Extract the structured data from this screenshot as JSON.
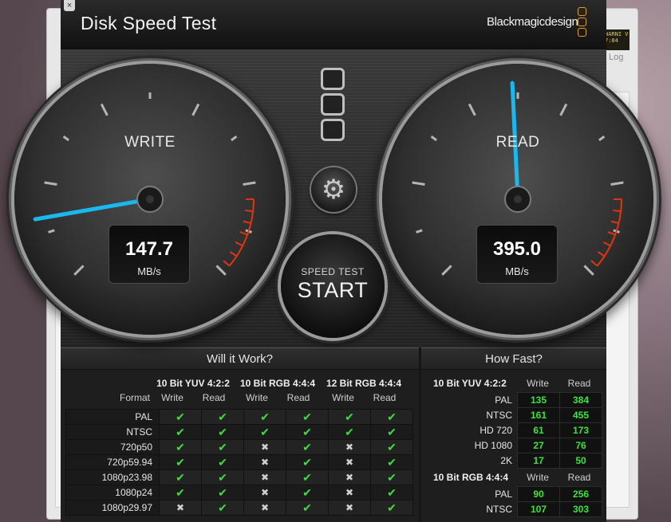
{
  "background": {
    "warning_text": "WARNI V 7:84",
    "log_label": "Log"
  },
  "app": {
    "title": "Disk Speed Test",
    "brand": "Blackmagicdesign",
    "close_glyph": "×",
    "colors": {
      "needle": "#19b8ee",
      "accent_red": "#e03512",
      "ok_green": "#3fdd3f",
      "logo_orange": "#e39b2b"
    }
  },
  "write_gauge": {
    "label": "WRITE",
    "value": "147.7",
    "unit": "MB/s",
    "needle_fraction": 0.13
  },
  "read_gauge": {
    "label": "READ",
    "value": "395.0",
    "unit": "MB/s",
    "needle_fraction": 0.49
  },
  "controls": {
    "gear_icon": "gear-icon",
    "start_small": "SPEED TEST",
    "start_big": "START"
  },
  "will_it_work": {
    "title": "Will it Work?",
    "format_header": "Format",
    "groups": [
      "10 Bit YUV 4:2:2",
      "10 Bit RGB 4:4:4",
      "12 Bit RGB 4:4:4"
    ],
    "sub": [
      "Write",
      "Read",
      "Write",
      "Read",
      "Write",
      "Read"
    ],
    "rows": [
      {
        "format": "PAL",
        "marks": [
          1,
          1,
          1,
          1,
          1,
          1
        ]
      },
      {
        "format": "NTSC",
        "marks": [
          1,
          1,
          1,
          1,
          1,
          1
        ]
      },
      {
        "format": "720p50",
        "marks": [
          1,
          1,
          0,
          1,
          0,
          1
        ]
      },
      {
        "format": "720p59.94",
        "marks": [
          1,
          1,
          0,
          1,
          0,
          1
        ]
      },
      {
        "format": "1080p23.98",
        "marks": [
          1,
          1,
          0,
          1,
          0,
          1
        ]
      },
      {
        "format": "1080p24",
        "marks": [
          1,
          1,
          0,
          1,
          0,
          1
        ]
      },
      {
        "format": "1080p29.97",
        "marks": [
          0,
          1,
          0,
          1,
          0,
          1
        ]
      }
    ],
    "ok_glyph": "✔",
    "no_glyph": "✖"
  },
  "how_fast": {
    "title": "How Fast?",
    "sections": [
      {
        "header": "10 Bit YUV 4:2:2",
        "write": "Write",
        "read": "Read",
        "rows": [
          {
            "label": "PAL",
            "w": "135",
            "r": "384"
          },
          {
            "label": "NTSC",
            "w": "161",
            "r": "455"
          },
          {
            "label": "HD 720",
            "w": "61",
            "r": "173"
          },
          {
            "label": "HD 1080",
            "w": "27",
            "r": "76"
          },
          {
            "label": "2K",
            "w": "17",
            "r": "50"
          }
        ]
      },
      {
        "header": "10 Bit RGB 4:4:4",
        "write": "Write",
        "read": "Read",
        "rows": [
          {
            "label": "PAL",
            "w": "90",
            "r": "256"
          },
          {
            "label": "NTSC",
            "w": "107",
            "r": "303"
          }
        ]
      }
    ]
  }
}
